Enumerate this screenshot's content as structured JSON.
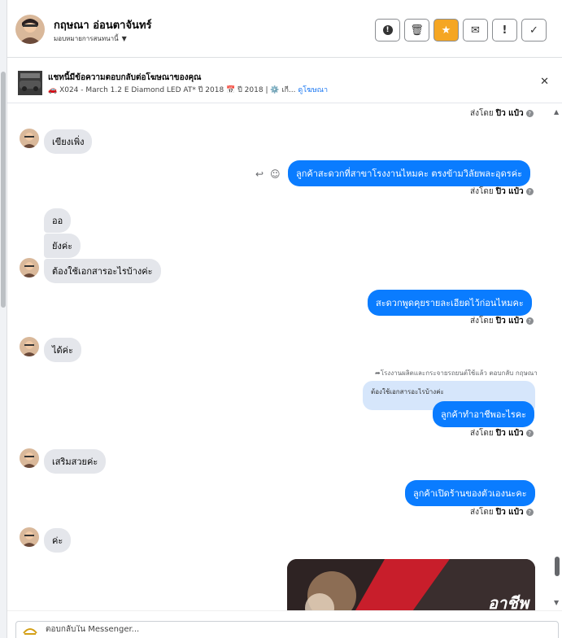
{
  "header": {
    "contact_name": "กฤษณา อ่อนตาจันทร์",
    "assign_label": "มอบหมายการสนทนานี้"
  },
  "ad": {
    "title": "แชทนี้มีข้อความตอบกลับต่อโฆษณาของคุณ",
    "subtitle_prefix": "🚗 X024 - March 1.2 E Diamond LED AT* ปี 2018 📅 ปี 2018 | ⚙️ เกี...",
    "subtitle_link": "ดูโฆษณา"
  },
  "sent_by": {
    "label": "ส่งโดย",
    "name": "ปิว แป๋ว"
  },
  "messages": {
    "m1": "เขียงเพิ่ง",
    "m2": "ลูกค้าสะดวกที่สาขาโรงงานไหมคะ ตรงข้ามวิลัยพละอุดรค่ะ",
    "m3": "ออ",
    "m4": "ยังค่ะ",
    "m5": "ต้องใช้เอกสารอะไรบ้างค่ะ",
    "m6": "สะดวกพูดคุยรายละเอียดไว้ก่อนไหมคะ",
    "m7": "ได้ค่ะ",
    "reply_note": "โรงงานผลิตและกระจายรถยนต์ใช้แล้ว ตอบกลับ กฤษณา",
    "quoted": "ต้องใช้เอกสารอะไรบ้างค่ะ",
    "m8": "ลูกค้าทำอาชีพอะไรคะ",
    "m9": "เสริมสวยค่ะ",
    "m10": "ลูกค้าเปิดร้านของตัวเองนะคะ",
    "m11": "ค่ะ",
    "image_text": "อาชีพ"
  },
  "composer": {
    "placeholder": "ตอบกลับใน Messenger..."
  },
  "colors": {
    "outgoing": "#0a7cff",
    "incoming": "#e4e6eb",
    "quoted": "#d6e6fb",
    "star": "#f5a623"
  }
}
